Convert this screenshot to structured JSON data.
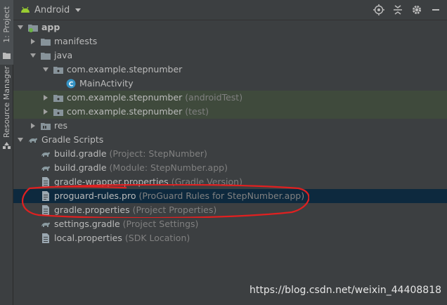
{
  "side_tabs": {
    "project": "1: Project",
    "resource_manager": "Resource Manager"
  },
  "toolbar": {
    "view_label": "Android",
    "icons": [
      "target-icon",
      "collapse-all-icon",
      "gear-icon",
      "minimize-icon"
    ]
  },
  "tree": [
    {
      "label": "app",
      "hint": "",
      "indent": 0,
      "arrow": "down",
      "icon": "module-icon",
      "bold": true
    },
    {
      "label": "manifests",
      "hint": "",
      "indent": 1,
      "arrow": "right",
      "icon": "folder-icon"
    },
    {
      "label": "java",
      "hint": "",
      "indent": 1,
      "arrow": "down",
      "icon": "folder-icon"
    },
    {
      "label": "com.example.stepnumber",
      "hint": "",
      "indent": 2,
      "arrow": "down",
      "icon": "package-icon"
    },
    {
      "label": "MainActivity",
      "hint": "",
      "indent": 3,
      "arrow": "none",
      "icon": "class-icon"
    },
    {
      "label": "com.example.stepnumber",
      "hint": "(androidTest)",
      "indent": 2,
      "arrow": "right",
      "icon": "package-icon",
      "tinted": true
    },
    {
      "label": "com.example.stepnumber",
      "hint": "(test)",
      "indent": 2,
      "arrow": "right",
      "icon": "package-icon",
      "tinted": true
    },
    {
      "label": "res",
      "hint": "",
      "indent": 1,
      "arrow": "right",
      "icon": "res-folder-icon"
    },
    {
      "label": "Gradle Scripts",
      "hint": "",
      "indent": 0,
      "arrow": "down",
      "icon": "gradle-icon"
    },
    {
      "label": "build.gradle",
      "hint": "(Project: StepNumber)",
      "indent": 1,
      "arrow": "none",
      "icon": "gradle-icon"
    },
    {
      "label": "build.gradle",
      "hint": "(Module: StepNumber.app)",
      "indent": 1,
      "arrow": "none",
      "icon": "gradle-icon"
    },
    {
      "label": "gradle-wrapper.properties",
      "hint": "(Gradle Version)",
      "indent": 1,
      "arrow": "none",
      "icon": "properties-file-icon"
    },
    {
      "label": "proguard-rules.pro",
      "hint": "(ProGuard Rules for StepNumber.app)",
      "indent": 1,
      "arrow": "none",
      "icon": "file-icon",
      "selected": true
    },
    {
      "label": "gradle.properties",
      "hint": "(Project Properties)",
      "indent": 1,
      "arrow": "none",
      "icon": "properties-file-icon"
    },
    {
      "label": "settings.gradle",
      "hint": "(Project Settings)",
      "indent": 1,
      "arrow": "none",
      "icon": "gradle-icon"
    },
    {
      "label": "local.properties",
      "hint": "(SDK Location)",
      "indent": 1,
      "arrow": "none",
      "icon": "properties-file-icon"
    }
  ],
  "watermark": "https://blog.csdn.net/weixin_44408818",
  "colors": {
    "selection": "#0d293e",
    "tint": "#3f4a3c",
    "annotation": "#e02020",
    "folder": "#87939a",
    "package": "#b0b0b0",
    "class": "#3592c4"
  }
}
